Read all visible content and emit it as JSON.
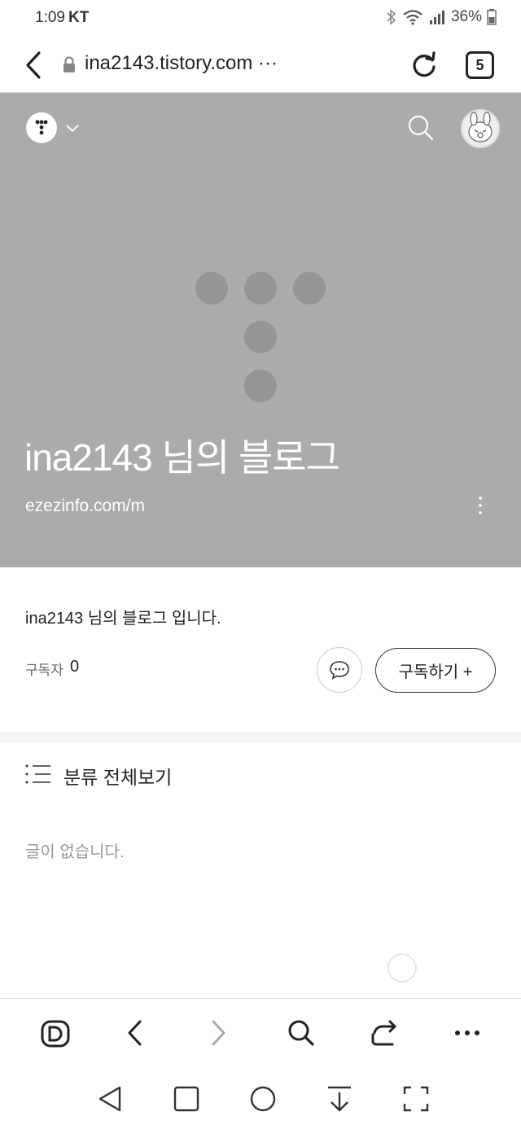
{
  "status_bar": {
    "time": "1:09",
    "carrier": "KT",
    "battery": "36%"
  },
  "browser": {
    "url": "ina2143.tistory.com ···",
    "tab_count": "5"
  },
  "banner": {
    "title": "ina2143 님의 블로그",
    "url": "ezezinfo.com/m",
    "background_color": "#ababab"
  },
  "blog": {
    "description": "ina2143 님의 블로그 입니다.",
    "subscriber_label": "구독자",
    "subscriber_count": "0",
    "subscribe_label": "구독하기 +"
  },
  "category": {
    "label": "분류 전체보기",
    "empty_text": "글이 없습니다."
  },
  "toolbar": {
    "icons": [
      "d-home-icon",
      "back-icon",
      "forward-icon",
      "search-icon",
      "share-icon",
      "more-icon"
    ]
  },
  "nav": {
    "icons": [
      "nav-back-icon",
      "nav-home-icon",
      "nav-circle-icon",
      "nav-down-icon",
      "nav-fullscreen-icon"
    ]
  }
}
